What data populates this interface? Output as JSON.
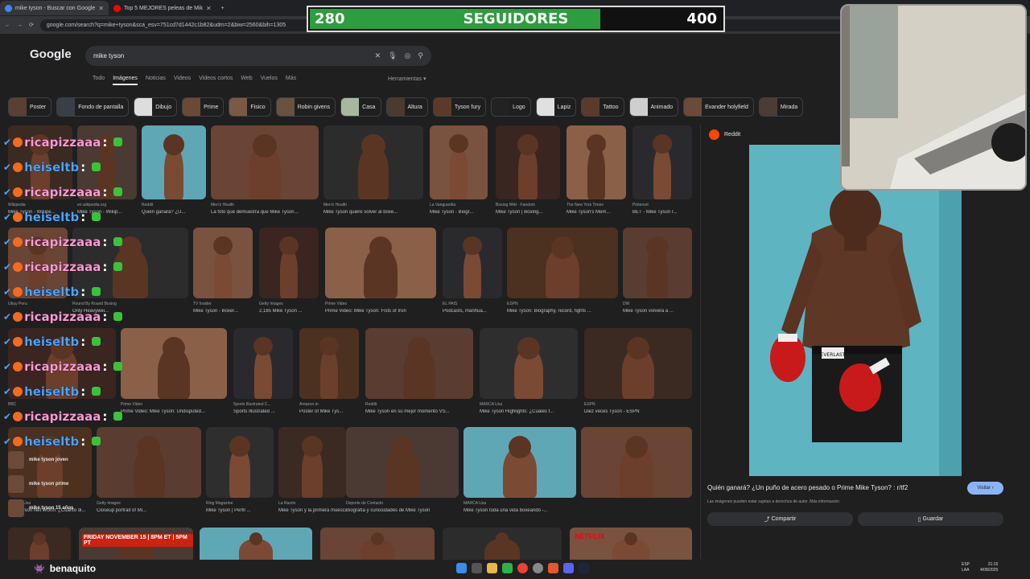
{
  "browser": {
    "tabs": [
      {
        "label": "mike tyson - Buscar con Google",
        "active": true
      },
      {
        "label": "Top 5 MEJORES peleas de Mik",
        "active": false
      }
    ],
    "url": "google.com/search?q=mike+tyson&sca_esv=751cd7d1442c1b82&udm=2&biw=2560&bih=1305"
  },
  "overlay": {
    "left": "280",
    "label": "SEGUIDORES",
    "right": "400",
    "progress": 0.7
  },
  "google": {
    "logo": "Google",
    "query": "mike tyson",
    "tabs": [
      "Todo",
      "Imágenes",
      "Noticias",
      "Videos",
      "Videos cortos",
      "Web",
      "Vuelos",
      "Más"
    ],
    "tools": "Herramientas"
  },
  "chips": [
    "Poster",
    "Fondo de pantalla",
    "Dibujo",
    "Prime",
    "Fisico",
    "Robin givens",
    "Casa",
    "Altura",
    "Tyson fury",
    "Logo",
    "Lapiz",
    "Tattoo",
    "Animado",
    "Evander holyfield",
    "Mirada"
  ],
  "results": [
    {
      "src": "Wikipedia",
      "cap": "Mike Tyson - Wikipe..."
    },
    {
      "src": "en.wikipedia.org",
      "cap": "Mike Tyson - Wikip..."
    },
    {
      "src": "Reddit",
      "cap": "Quién ganará? ¿U..."
    },
    {
      "src": "Men's Health",
      "cap": "La foto que demuestra que Mike Tyson..."
    },
    {
      "src": "Men's Health",
      "cap": "Mike Tyson quiere volver al boxe..."
    },
    {
      "src": "La Vanguardia",
      "cap": "Mike Tyson - Biogr..."
    },
    {
      "src": "Boxing Wiki - Fandom",
      "cap": "Mike Tyson | Boxing..."
    },
    {
      "src": "The New York Times",
      "cap": "Mike Tyson's Mem..."
    },
    {
      "src": "Pinterest",
      "cap": "BET - Mike Tyson r..."
    },
    {
      "src": "Ubuy Peru",
      "cap": ""
    },
    {
      "src": "Round By Round Boxing",
      "cap": "Only Heavywei..."
    },
    {
      "src": "TV Insider",
      "cap": "Mike Tyson - Boxer..."
    },
    {
      "src": "Getty Images",
      "cap": "2,185 Mike Tyson ..."
    },
    {
      "src": "Prime Video",
      "cap": "Prime Video: Mike Tyson: Fists of Iron"
    },
    {
      "src": "EL PAÍS",
      "cap": "Podcasts, marihua..."
    },
    {
      "src": "ESPN",
      "cap": "Mike Tyson: Biography, record, fights ..."
    },
    {
      "src": "DW",
      "cap": "Mike Tyson volverá a ..."
    },
    {
      "src": "BBC",
      "cap": ""
    },
    {
      "src": "Prime Video",
      "cap": "Prime Video: Mike Tyson: Undisputed..."
    },
    {
      "src": "Sports Illustrated C...",
      "cap": "Sports Illustrated ..."
    },
    {
      "src": "Amazon.in",
      "cap": "Poster of Mike Tys..."
    },
    {
      "src": "Reddit",
      "cap": "Mike Tyson en su mejor momento VS..."
    },
    {
      "src": "MARCA Usa",
      "cap": "Mike Tyson Highlights: ¿Cuáles f..."
    },
    {
      "src": "ESPN",
      "cap": "Diez veces Tyson - ESPN"
    },
    {
      "src": "MARCA Usa",
      "cap": "Mike Tyson Net Worth: ¿Cuánto di..."
    },
    {
      "src": "Getty Images",
      "cap": "Closeup portrait of Mi..."
    },
    {
      "src": "Ring Magazine",
      "cap": "Mike Tyson | Perfil ..."
    },
    {
      "src": "La Razón",
      "cap": "Mike Tyson y la primera muesca del pi..."
    },
    {
      "src": "Deporte de Contacto",
      "cap": "Biografía y curiosidades de Mike Tyson"
    },
    {
      "src": "MARCA Usa",
      "cap": "Mike Tyson toda una vida boxeando -..."
    }
  ],
  "bottom_banners": [
    "FRIDAY NOVEMBER 15 | 8PM ET | 5PM PT",
    "NETFLIX"
  ],
  "related": [
    "mike tyson joven",
    "mike tyson prime",
    "mike tyson 15 años"
  ],
  "side": {
    "source": "Reddit",
    "title": "Quién ganará? ¿Un puño de acero pesado o Prime Mike Tyson? : r/tf2",
    "visit": "Visitar",
    "note": "Las imágenes pueden estar sujetas a derechos de autor. Más información",
    "share": "Compartir",
    "save": "Guardar",
    "trunks_text": "EVERLAST"
  },
  "chat": [
    {
      "user": "ricapizzaaa",
      "color": "#ff9ad5"
    },
    {
      "user": "heiseltb",
      "color": "#4da3ff"
    },
    {
      "user": "ricapizzaaa",
      "color": "#ff9ad5"
    },
    {
      "user": "heiseltb",
      "color": "#4da3ff"
    },
    {
      "user": "ricapizzaaa",
      "color": "#ff9ad5"
    },
    {
      "user": "ricapizzaaa",
      "color": "#ff9ad5"
    },
    {
      "user": "heiseltb",
      "color": "#4da3ff"
    },
    {
      "user": "ricapizzaaa",
      "color": "#ff9ad5"
    },
    {
      "user": "heiseltb",
      "color": "#4da3ff"
    },
    {
      "user": "ricapizzaaa",
      "color": "#ff9ad5"
    },
    {
      "user": "heiseltb",
      "color": "#4da3ff"
    },
    {
      "user": "ricapizzaaa",
      "color": "#ff9ad5"
    },
    {
      "user": "heiseltb",
      "color": "#4da3ff"
    }
  ],
  "chat_colon": ":",
  "streamer": "benaquito",
  "taskbar": {
    "lang": "ESP",
    "lang2": "LAA",
    "time": "21:15",
    "date": "4/08/2025"
  }
}
